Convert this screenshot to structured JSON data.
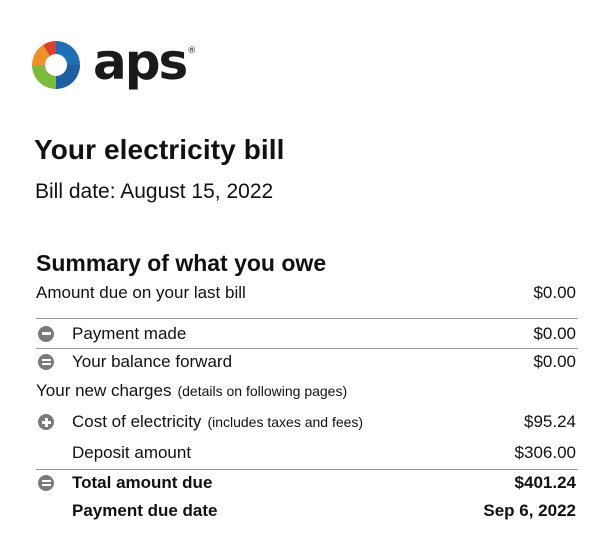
{
  "brand": {
    "name": "aps",
    "registered": "®"
  },
  "bill": {
    "title": "Your electricity bill",
    "date": "Bill date: August 15, 2022"
  },
  "summary": {
    "heading": "Summary of what you owe",
    "last_bill": {
      "label": "Amount due on your last bill",
      "value": "$0.00"
    },
    "payment_made": {
      "label": "Payment made",
      "value": "$0.00",
      "icon": "minus-circle-icon"
    },
    "balance_forward": {
      "label": "Your balance forward",
      "value": "$0.00",
      "icon": "minus-circle-icon"
    },
    "new_charges": {
      "label": "Your new charges",
      "note": "(details on following pages)"
    },
    "cost_of_electricity": {
      "label": "Cost of electricity",
      "note": "(includes taxes and fees)",
      "value": "$95.24",
      "icon": "plus-circle-icon"
    },
    "deposit": {
      "label": "Deposit amount",
      "value": "$306.00"
    },
    "total": {
      "label": "Total amount due",
      "value": "$401.24",
      "icon": "equals-circle-icon"
    },
    "due_date": {
      "label": "Payment due date",
      "value": "Sep 6, 2022"
    }
  },
  "colors": {
    "logo_blue": "#1f6fb5",
    "logo_green": "#7cbb3c",
    "logo_orange": "#f0902a",
    "logo_red": "#d9412b",
    "icon_gray": "#7a7a7a",
    "divider_gray": "#9a9a9a"
  }
}
